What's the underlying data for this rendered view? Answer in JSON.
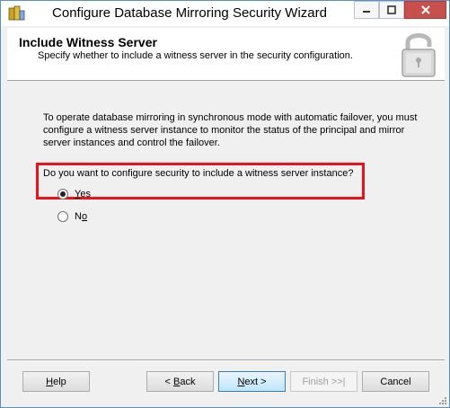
{
  "window": {
    "title": "Configure Database Mirroring Security Wizard"
  },
  "header": {
    "title": "Include Witness Server",
    "subtitle": "Specify whether to include a witness server in the security configuration.",
    "icon": "padlock-icon"
  },
  "content": {
    "intro": "To operate database mirroring in synchronous mode with automatic failover, you must configure a witness server instance to monitor the status of the principal and mirror server instances and control the failover.",
    "question": "Do you want to configure security to include a witness server instance?",
    "options": [
      {
        "label": "Yes",
        "accel": "Y",
        "rest": "es",
        "selected": true
      },
      {
        "label": "No",
        "pre": "N",
        "accel": "o",
        "selected": false
      }
    ],
    "highlight_color": "#e8141c"
  },
  "footer": {
    "help": {
      "accel": "H",
      "rest": "elp"
    },
    "back": {
      "pre": "< ",
      "accel": "B",
      "rest": "ack"
    },
    "next": {
      "accel": "N",
      "rest": "ext >"
    },
    "finish": "Finish >>|",
    "cancel": "Cancel"
  }
}
